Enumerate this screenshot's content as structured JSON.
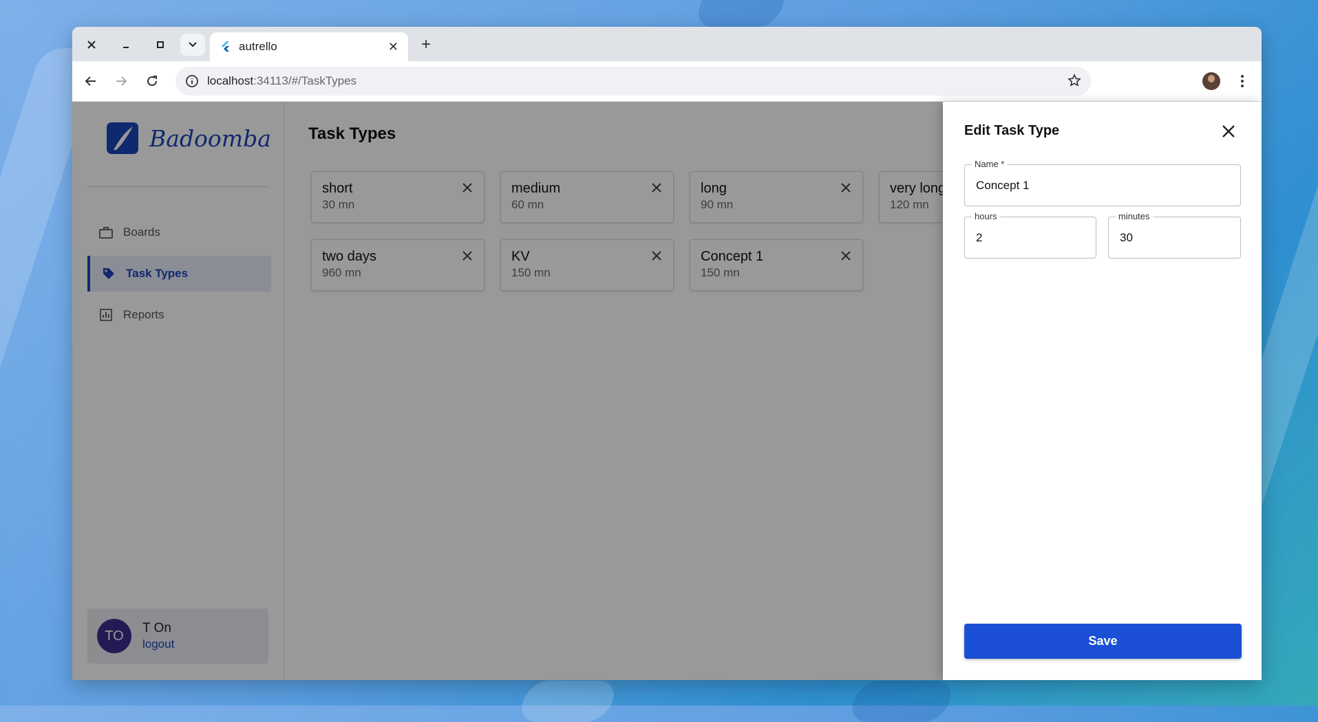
{
  "browser": {
    "tab_title": "autrello",
    "url_host": "localhost",
    "url_rest": ":34113/#/TaskTypes"
  },
  "sidebar": {
    "logo_text": "Badoomba",
    "nav": [
      {
        "label": "Boards",
        "icon": "briefcase-icon"
      },
      {
        "label": "Task Types",
        "icon": "tag-icon"
      },
      {
        "label": "Reports",
        "icon": "chart-icon"
      }
    ],
    "user": {
      "initials": "TO",
      "name": "T On",
      "logout_label": "logout"
    }
  },
  "main": {
    "title": "Task Types",
    "cards": [
      {
        "name": "short",
        "duration": "30 mn"
      },
      {
        "name": "medium",
        "duration": "60 mn"
      },
      {
        "name": "long",
        "duration": "90 mn"
      },
      {
        "name": "very long",
        "duration": "120 mn"
      },
      {
        "name": "two days",
        "duration": "960 mn"
      },
      {
        "name": "KV",
        "duration": "150 mn"
      },
      {
        "name": "Concept 1",
        "duration": "150 mn"
      }
    ]
  },
  "drawer": {
    "title": "Edit Task Type",
    "name_label": "Name *",
    "name_value": "Concept 1",
    "hours_label": "hours",
    "hours_value": "2",
    "minutes_label": "minutes",
    "minutes_value": "30",
    "save_label": "Save"
  },
  "colors": {
    "brand": "#1a45b8",
    "save_button": "#1a4fd6",
    "avatar": "#3a2e8c"
  }
}
